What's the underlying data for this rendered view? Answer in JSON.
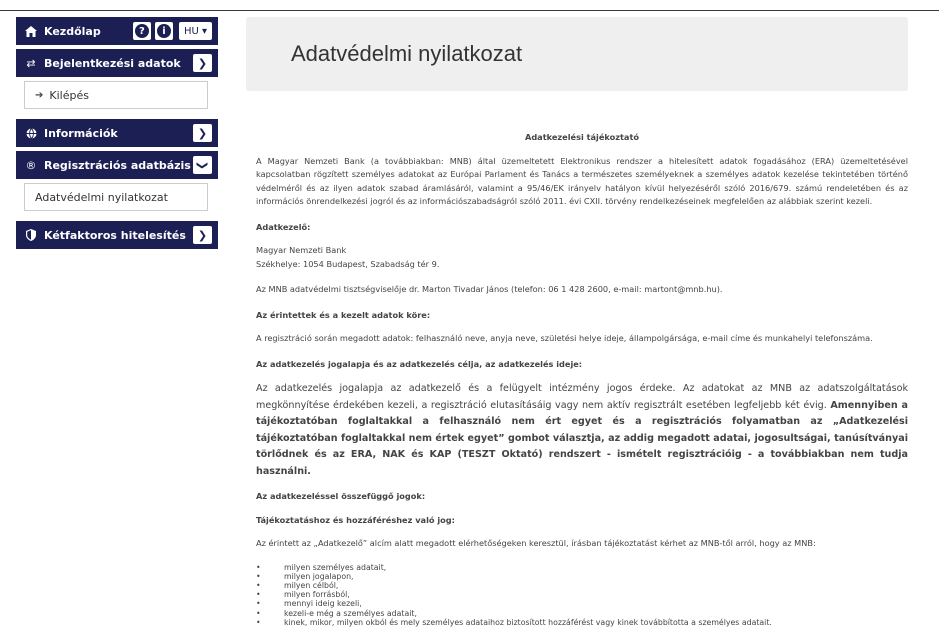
{
  "sidebar": {
    "home_label": "Kezdőlap",
    "help_glyph": "?",
    "info_glyph": "i",
    "lang_label": "HU ▾",
    "login_data_label": "Bejelentkezési adatok",
    "logout_label": "Kilépés",
    "info_label": "Információk",
    "registry_label": "Regisztrációs adatbázis",
    "privacy_label": "Adatvédelmi nyilatkozat",
    "twofactor_label": "Kétfaktoros hitelesítés",
    "chevron_right": "❯",
    "chevron_down": "❯"
  },
  "page": {
    "title": "Adatvédelmi nyilatkozat"
  },
  "content": {
    "title": "Adatkezelési tájékoztató",
    "intro": "A Magyar Nemzeti Bank (a továbbiakban: MNB) által üzemeltetett Elektronikus rendszer a hitelesített adatok fogadásához (ERA) üzemeltetésével kapcsolatban rögzített személyes adatokat az Európai Parlament és Tanács a természetes személyeknek a személyes adatok kezelése tekintetében történő védelméről és az ilyen adatok szabad áramlásáról, valamint a 95/46/EK irányelv hatályon kívül helyezéséről szóló 2016/679. számú rendeletében és az információs önrendelkezési jogról és az információszabadságról szóló 2011. évi CXII. törvény rendelkezéseinek megfelelően az alábbiak szerint kezeli.",
    "controller_heading": "Adatkezelő:",
    "controller_name": "Magyar Nemzeti Bank",
    "controller_seat": "Székhelye: 1054 Budapest, Szabadság tér 9.",
    "dpo": "Az MNB adatvédelmi tisztségviselője dr. Marton Tivadar János (telefon: 06 1 428 2600, e-mail: martont@mnb.hu).",
    "scope_heading": "Az érintettek és a kezelt adatok köre:",
    "scope_text": "A regisztráció során megadott adatok: felhasználó neve, anyja neve, születési helye ideje, állampolgársága, e-mail címe és munkahelyi telefonszáma.",
    "basis_heading": "Az adatkezelés jogalapja és az adatkezelés célja, az adatkezelés ideje:",
    "basis_text": "Az adatkezelés jogalapja az adatkezelő és a felügyelt intézmény jogos érdeke. Az adatokat az MNB az adatszolgáltatások megkönnyítése érdekében kezeli, a regisztráció elutasításáig vagy nem aktív regisztrált esetében legfeljebb két évig.",
    "basis_bold": "Amennyiben a tájékoztatóban foglaltakkal a felhasználó nem ért egyet és a regisztrációs folyamatban az „Adatkezelési tájékoztatóban foglaltakkal nem értek egyet” gombot választja, az addig megadott adatai, jogosultságai, tanúsítványai törlődnek és az ERA, NAK és KAP (TESZT Oktató) rendszert - ismételt regisztrációig - a továbbiakban nem tudja használni.",
    "rights_heading": "Az adatkezeléssel összefüggő jogok:",
    "access_heading": "Tájékoztatáshoz és hozzáféréshez való jog:",
    "access_text": "Az érintett az „Adatkezelő” alcím alatt megadott elérhetőségeken keresztül, írásban tájékoztatást kérhet az MNB-től arról, hogy az MNB:",
    "bullets": [
      "milyen személyes adatait,",
      "milyen jogalapon,",
      "milyen célból,",
      "milyen forrásból,",
      "mennyi ideig kezeli,",
      "kezeli-e még a személyes adatait,",
      "kinek, mikor, milyen okból és mely személyes adataihoz biztosított hozzáférést vagy kinek továbbította a személyes adatait."
    ]
  }
}
